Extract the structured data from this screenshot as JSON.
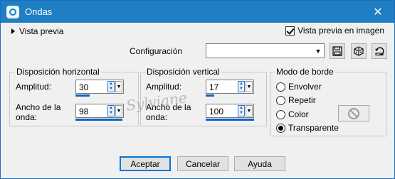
{
  "window": {
    "title": "Ondas",
    "close_glyph": "✕"
  },
  "preview": {
    "toggle_label": "Vista previa",
    "checkbox_label": "Vista previa en imagen",
    "checkbox_checked": true
  },
  "config": {
    "label": "Configuración",
    "value": "",
    "buttons": [
      "save-icon",
      "dice-icon",
      "reset-icon"
    ]
  },
  "horizontal": {
    "title": "Disposición horizontal",
    "amplitude_label": "Amplitud:",
    "amplitude_value": "30",
    "wavelength_label_1": "Ancho de la",
    "wavelength_label_2": "onda:",
    "wavelength_value": "98"
  },
  "vertical": {
    "title": "Disposición vertical",
    "amplitude_label": "Amplitud:",
    "amplitude_value": "17",
    "wavelength_label_1": "Ancho de la",
    "wavelength_label_2": "onda:",
    "wavelength_value": "100"
  },
  "edge": {
    "title": "Modo de borde",
    "options": [
      "Envolver",
      "Repetir",
      "Color",
      "Transparente"
    ],
    "selected": "Transparente"
  },
  "watermark": "Sylviane",
  "buttons": {
    "ok": "Aceptar",
    "cancel": "Cancelar",
    "help": "Ayuda"
  },
  "colors": {
    "titlebar": "#1f7ec4",
    "accent": "#0a62c6"
  }
}
